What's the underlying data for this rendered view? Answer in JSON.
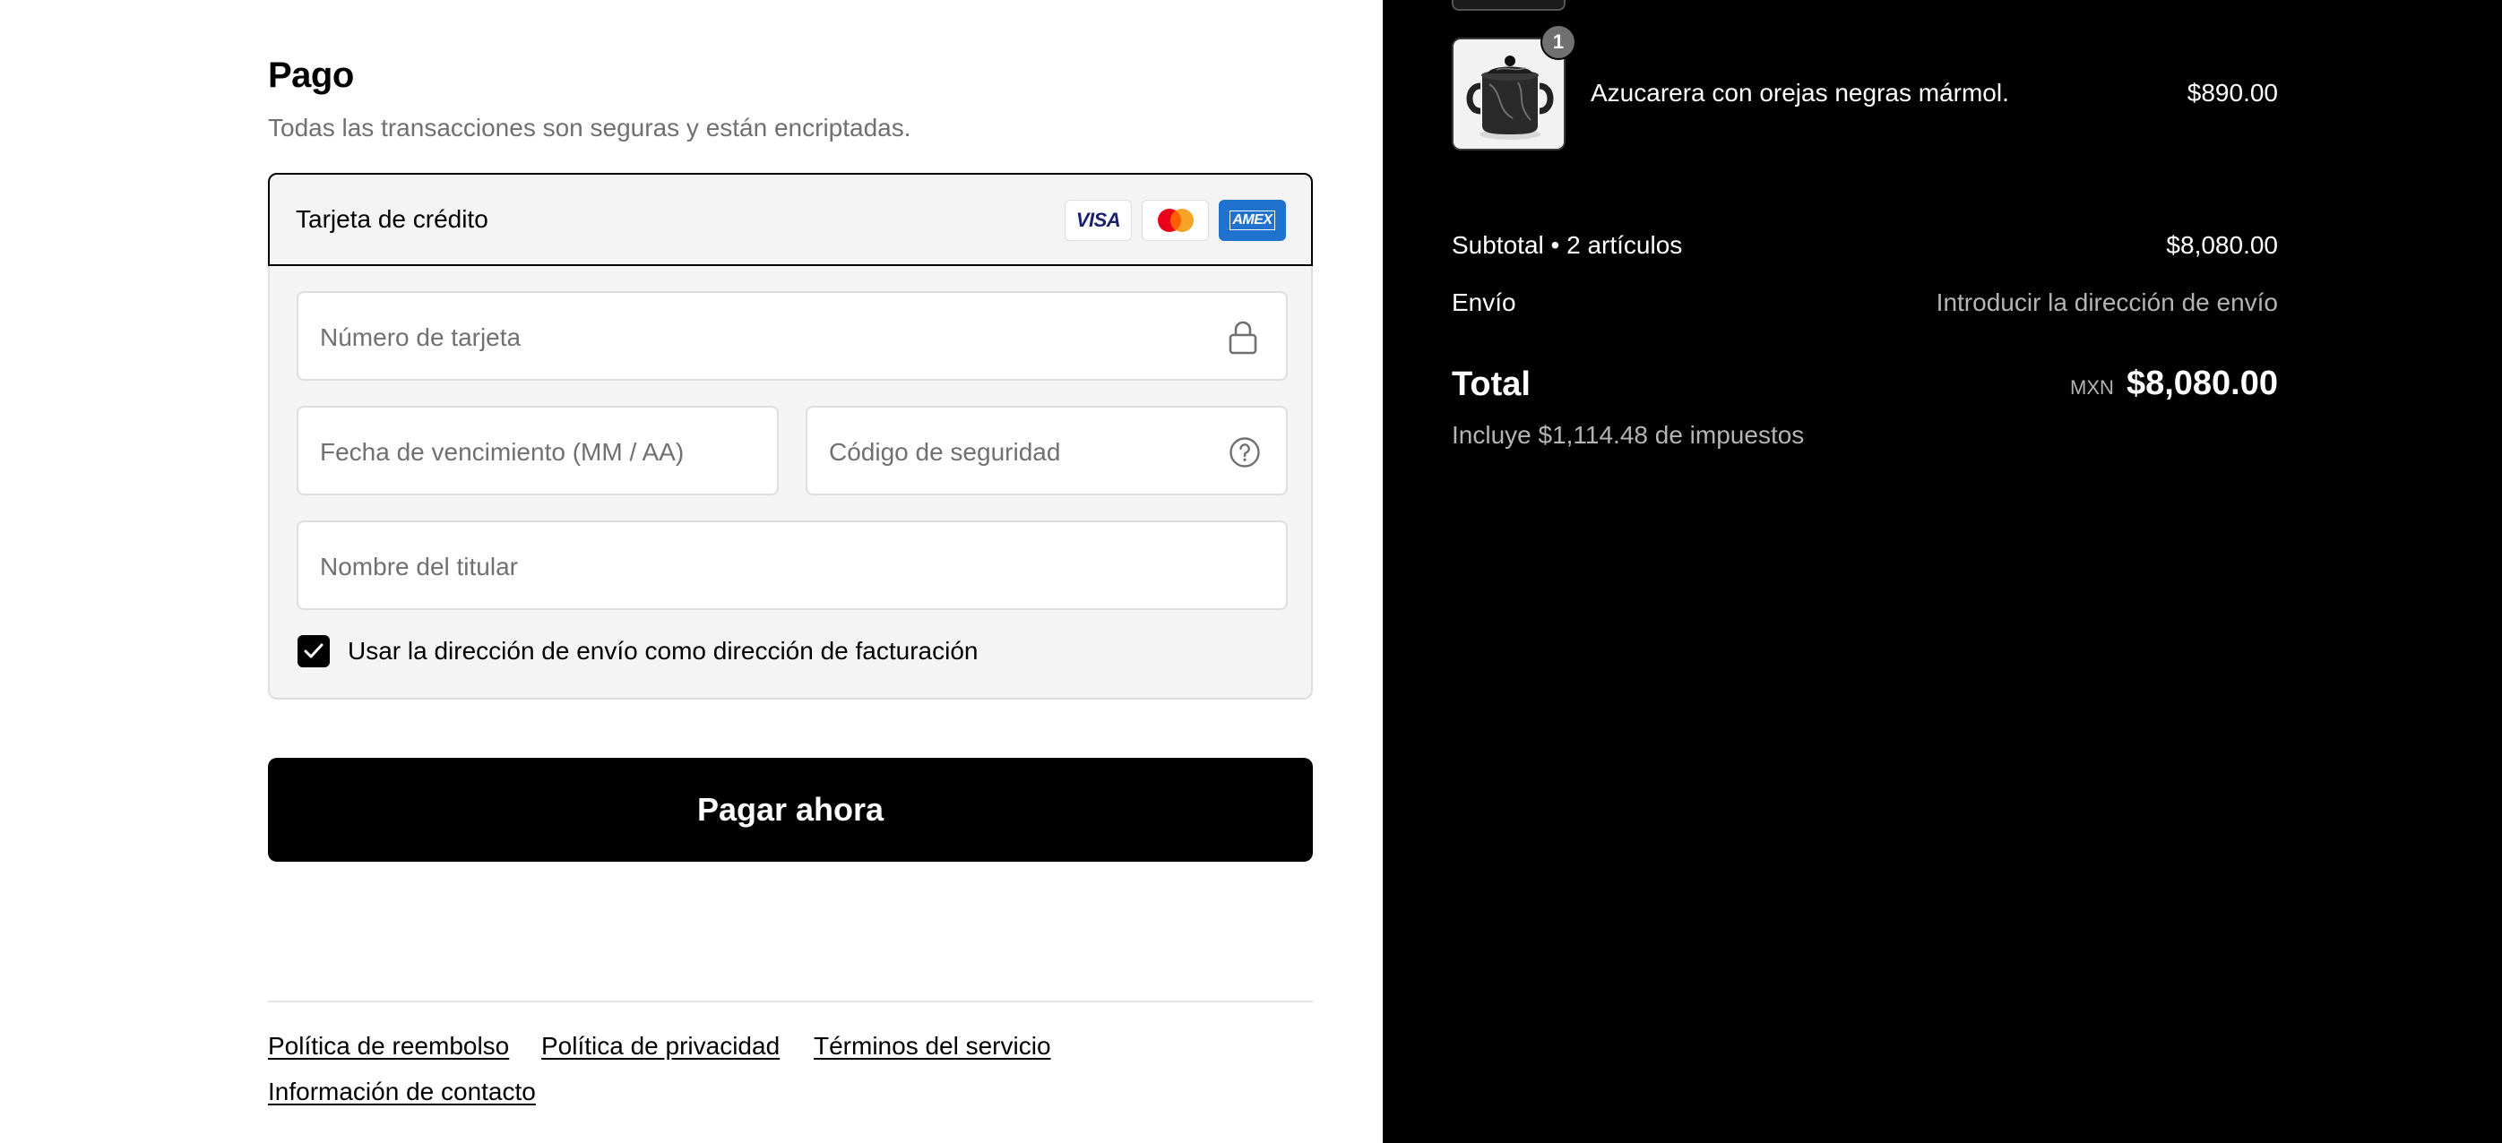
{
  "payment": {
    "title": "Pago",
    "subtitle": "Todas las transacciones son seguras y están encriptadas.",
    "method_label": "Tarjeta de crédito",
    "brands": {
      "visa": "VISA",
      "amex": "AMEX"
    },
    "fields": {
      "card_number_placeholder": "Número de tarjeta",
      "expiry_placeholder": "Fecha de vencimiento (MM / AA)",
      "security_code_placeholder": "Código de seguridad",
      "name_placeholder": "Nombre del titular"
    },
    "billing_checkbox": {
      "label": "Usar la dirección de envío como dirección de facturación",
      "checked": true
    },
    "pay_button": "Pagar ahora"
  },
  "footer": {
    "links": {
      "refund": "Política de reembolso",
      "privacy": "Política de privacidad",
      "terms": "Términos del servicio",
      "contact": "Información de contacto"
    }
  },
  "order": {
    "item": {
      "name": "Azucarera con orejas negras mármol.",
      "price": "$890.00",
      "quantity": "1"
    },
    "subtotal_label": "Subtotal • 2 artículos",
    "subtotal_value": "$8,080.00",
    "shipping_label": "Envío",
    "shipping_value": "Introducir la dirección de envío",
    "total_label": "Total",
    "currency": "MXN",
    "total_value": "$8,080.00",
    "tax_note": "Incluye $1,114.48 de impuestos"
  },
  "colors": {
    "accent": "#000000",
    "panel_bg": "#f4f4f4",
    "muted_text": "#707070",
    "amex_blue": "#1f72cd",
    "mastercard_red": "#eb001b",
    "mastercard_orange": "#f79e1b"
  }
}
